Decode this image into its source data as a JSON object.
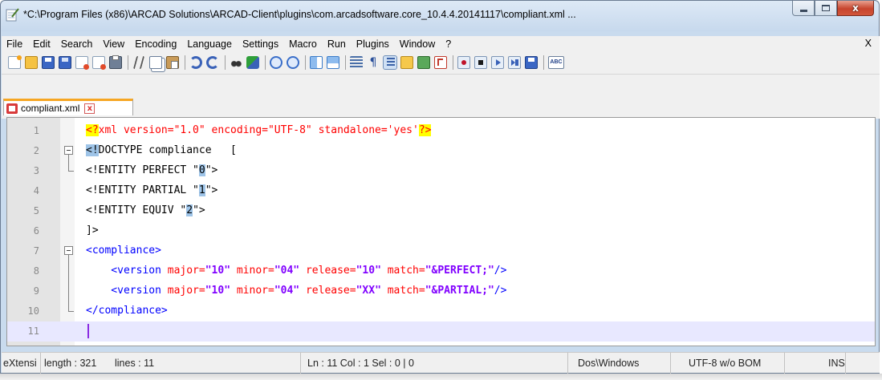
{
  "window": {
    "title": "*C:\\Program Files (x86)\\ARCAD Solutions\\ARCAD-Client\\plugins\\com.arcadsoftware.core_10.4.4.20141117\\compliant.xml ...",
    "close_glyph": "x"
  },
  "menu": {
    "items": [
      "File",
      "Edit",
      "Search",
      "View",
      "Encoding",
      "Language",
      "Settings",
      "Macro",
      "Run",
      "Plugins",
      "Window",
      "?"
    ],
    "close_doc": "X"
  },
  "toolbar": {
    "icons": [
      "new-file-icon",
      "open-file-icon",
      "save-icon",
      "save-all-icon",
      "close-icon",
      "close-all-icon",
      "print-icon",
      "cut-icon",
      "copy-icon",
      "paste-icon",
      "undo-icon",
      "redo-icon",
      "find-icon",
      "replace-icon",
      "zoom-in-icon",
      "zoom-out-icon",
      "sync-vertical-icon",
      "sync-horizontal-icon",
      "word-wrap-icon",
      "show-all-chars-icon",
      "indent-guide-icon",
      "language-icon",
      "document-map-icon",
      "function-list-icon",
      "record-macro-icon",
      "stop-macro-icon",
      "play-macro-icon",
      "run-macro-multiple-icon",
      "save-macro-icon",
      "spellcheck-icon"
    ],
    "spellcheck_label": "ABC"
  },
  "tab": {
    "label": "compliant.xml",
    "close_glyph": "x"
  },
  "editor": {
    "line_numbers": [
      "1",
      "2",
      "3",
      "4",
      "5",
      "6",
      "7",
      "8",
      "9",
      "10",
      "11"
    ],
    "lines": {
      "l1": {
        "pi_open": "<?",
        "body": "xml version=\"1.0\" encoding=\"UTF-8\" standalone='yes'",
        "pi_close": "?>"
      },
      "l2": {
        "open": "<!",
        "body": "DOCTYPE compliance   ["
      },
      "l3": {
        "a": "<!ENTITY PERFECT \"",
        "v": "0",
        "b": "\">"
      },
      "l4": {
        "a": "<!ENTITY PARTIAL \"",
        "v": "1",
        "b": "\">"
      },
      "l5": {
        "a": "<!ENTITY EQUIV \"",
        "v": "2",
        "b": "\">"
      },
      "l6": {
        "text": "]>"
      },
      "l7": {
        "text": "<compliance>"
      },
      "l8": {
        "tag": "    <version",
        "a1": " major=",
        "v1": "\"10\"",
        "a2": " minor=",
        "v2": "\"04\"",
        "a3": " release=",
        "v3": "\"10\"",
        "a4": " match=",
        "v4": "\"&PERFECT;\"",
        "end": "/>"
      },
      "l9": {
        "tag": "    <version",
        "a1": " major=",
        "v1": "\"10\"",
        "a2": " minor=",
        "v2": "\"04\"",
        "a3": " release=",
        "v3": "\"XX\"",
        "a4": " match=",
        "v4": "\"&PARTIAL;\"",
        "end": "/>"
      },
      "l10": {
        "text": "</compliance>"
      }
    }
  },
  "status": {
    "lang": "eXtensi",
    "length": "length : 321",
    "lines": "lines : 11",
    "position": "Ln : 11   Col : 1   Sel : 0 | 0",
    "eol": "Dos\\Windows",
    "encoding": "UTF-8 w/o BOM",
    "mode": "INS"
  }
}
